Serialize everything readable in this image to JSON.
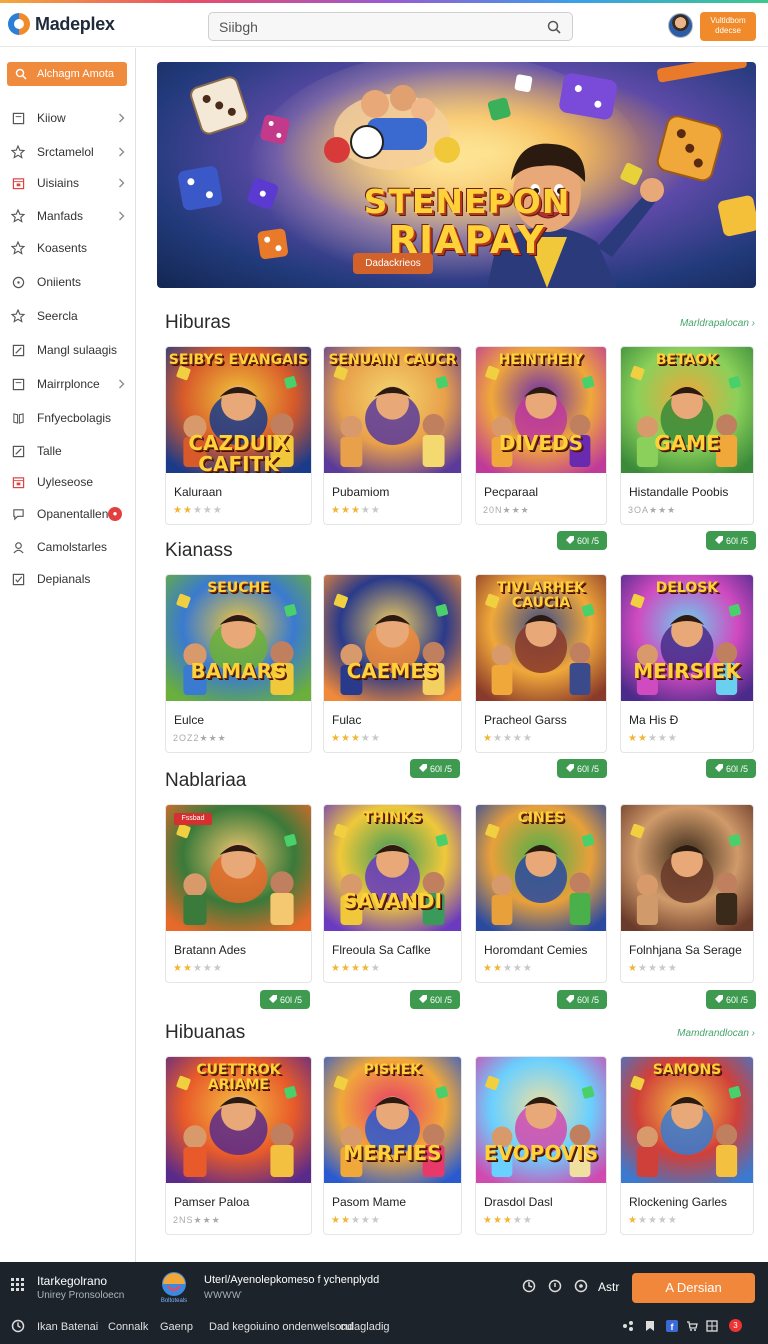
{
  "header": {
    "logo_text": "Madeplex",
    "search_value": "Siibgh",
    "cta_label": "Vultldbom ddecse"
  },
  "sidebar": {
    "cta_label": "Alchagm Amota",
    "items": [
      {
        "label": "Kiiow",
        "icon": "square-icon",
        "chevron": true
      },
      {
        "label": "Srctamelol",
        "icon": "star-icon",
        "chevron": true
      },
      {
        "label": "Uisiains",
        "icon": "calendar-icon",
        "chevron": true
      },
      {
        "label": "Manfads",
        "icon": "star-icon",
        "chevron": true
      },
      {
        "label": "Koasents",
        "icon": "star-icon",
        "chevron": false
      },
      {
        "label": "Oniients",
        "icon": "circle-icon",
        "chevron": false
      },
      {
        "label": "Seercla",
        "icon": "star-icon",
        "chevron": false
      },
      {
        "label": "Mangl sulaagis",
        "icon": "edit-icon",
        "chevron": false
      },
      {
        "label": "Mairrplonce",
        "icon": "square-icon",
        "chevron": true
      },
      {
        "label": "Fnfyecbolagis",
        "icon": "book-icon",
        "chevron": false
      },
      {
        "label": "Talle",
        "icon": "edit-icon",
        "chevron": false
      },
      {
        "label": "Uyleseose",
        "icon": "calendar-icon",
        "chevron": false
      },
      {
        "label": "Opanentallen",
        "icon": "chat-icon",
        "chevron": false,
        "badge": "●"
      },
      {
        "label": "Camolstarles",
        "icon": "user-icon",
        "chevron": false
      },
      {
        "label": "Depianals",
        "icon": "check-icon",
        "chevron": false
      }
    ]
  },
  "hero": {
    "title_line1": "STENEPON",
    "title_line2": "RIAPAY",
    "button_label": "Dadackrieos"
  },
  "sections": [
    {
      "title": "Hiburas",
      "link": "Marldrapalocan",
      "cards": [
        {
          "name": "Kaluraan",
          "thumb_title": "SEIBYS EVANGAIS",
          "thumb_sub": "CAZDUIX CAFITK",
          "stars": 2
        },
        {
          "name": "Pubamiom",
          "thumb_title": "SENUAIN CAUCR",
          "thumb_sub": "",
          "stars": 3
        },
        {
          "name": "Pecparaal",
          "thumb_title": "HEINTHEIY",
          "thumb_sub": "DIVEDS",
          "stars_text": "20N★★★"
        },
        {
          "name": "Histandalle Poobis",
          "thumb_title": "BETAOK",
          "thumb_sub": "GAME",
          "stars_text": "3OA★★★"
        }
      ],
      "prices": [
        "",
        "",
        "60Ɩ /5",
        "60Ɩ /5"
      ]
    },
    {
      "title": "Kianass",
      "link": "",
      "cards": [
        {
          "name": "Eulce",
          "thumb_title": "SEUCHE",
          "thumb_sub": "BAMARS",
          "stars_text": "2OZ2★★★"
        },
        {
          "name": "Fulac",
          "thumb_title": "",
          "thumb_sub": "CAEMES",
          "stars": 3
        },
        {
          "name": "Pracheol Garss",
          "thumb_title": "TIVLARHEK CAUCIA",
          "thumb_sub": "",
          "stars": 1
        },
        {
          "name": "Ma His Ð",
          "thumb_title": "DELOSK",
          "thumb_sub": "MEIRSIEK",
          "stars": 2
        }
      ],
      "prices": [
        "",
        "60Ɩ /5",
        "60Ɩ /5",
        "60Ɩ /5"
      ]
    },
    {
      "title": "Nablariaa",
      "link": "",
      "cards": [
        {
          "name": "Bratann Ades",
          "thumb_title": "",
          "thumb_sub": "",
          "stars": 2,
          "tag": "Fssbad"
        },
        {
          "name": "Flreoula Sa Caflke",
          "thumb_title": "THINKS",
          "thumb_sub": "SAVANDI",
          "stars": 4
        },
        {
          "name": "Horomdant Cemies",
          "thumb_title": "CINES",
          "thumb_sub": "",
          "stars": 2
        },
        {
          "name": "Folnhjana Sa Serage",
          "thumb_title": "",
          "thumb_sub": "",
          "stars": 1
        }
      ],
      "prices": [
        "60Ɩ /5",
        "60Ɩ /5",
        "60Ɩ /5",
        "60Ɩ /5"
      ]
    },
    {
      "title": "Hibuanas",
      "link": "Mamdrandlocan",
      "cards": [
        {
          "name": "Pamser Paloa",
          "thumb_title": "CUETTROK ARIAME",
          "thumb_sub": "",
          "stars_text": "2NS★★★"
        },
        {
          "name": "Pasom Mame",
          "thumb_title": "PISHEK",
          "thumb_sub": "MERFIES",
          "stars": 2
        },
        {
          "name": "Drasdol Dasl",
          "thumb_title": "",
          "thumb_sub": "EVOPOVIS",
          "stars": 3
        },
        {
          "name": "Rlockening Garles",
          "thumb_title": "SAMONS",
          "thumb_sub": "",
          "stars": 1
        }
      ],
      "prices": [
        "",
        "",
        "",
        ""
      ]
    }
  ],
  "bottombar": {
    "title": "Itarkegolrano",
    "subtitle": "Unirey Pronsoloecn",
    "logo_caption": "Boltoteals",
    "url": "Uterl/Ayenolepkomeso f ychenplydd",
    "url_sub": "ⱲⱲⱲⱲ",
    "label": "Astr",
    "button_label": "A Dersian",
    "links": [
      "Ikan Batenai",
      "Connalk",
      "Gaenp",
      "Dad kegoiuino ondenwelsond",
      "culagladig"
    ],
    "badge": "3"
  },
  "colors": {
    "accent_orange": "#f08a2a",
    "price_green": "#3d9a4f",
    "bottom_bar": "#1d232b"
  }
}
